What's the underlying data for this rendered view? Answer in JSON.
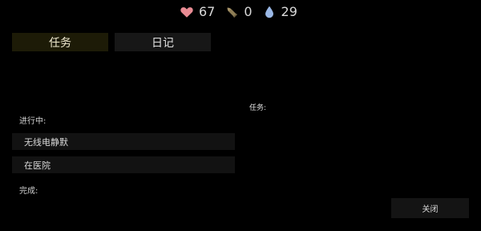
{
  "stats": {
    "health": {
      "icon": "heart-icon",
      "value": "67",
      "color": "#e98c94"
    },
    "ammo": {
      "icon": "bullet-icon",
      "value": "0",
      "color": "#8f7e56"
    },
    "water": {
      "icon": "water-drop-icon",
      "value": "29",
      "color": "#9ab8e6"
    }
  },
  "tabs": {
    "quests_label": "任务",
    "diary_label": "日记",
    "active": "quests"
  },
  "quest_list": {
    "active_heading": "进行中:",
    "active_items": [
      {
        "label": "无线电静默"
      },
      {
        "label": "在医院"
      }
    ],
    "completed_heading": "完成:"
  },
  "details": {
    "quest_label": "任务:"
  },
  "footer": {
    "close_label": "关闭"
  }
}
